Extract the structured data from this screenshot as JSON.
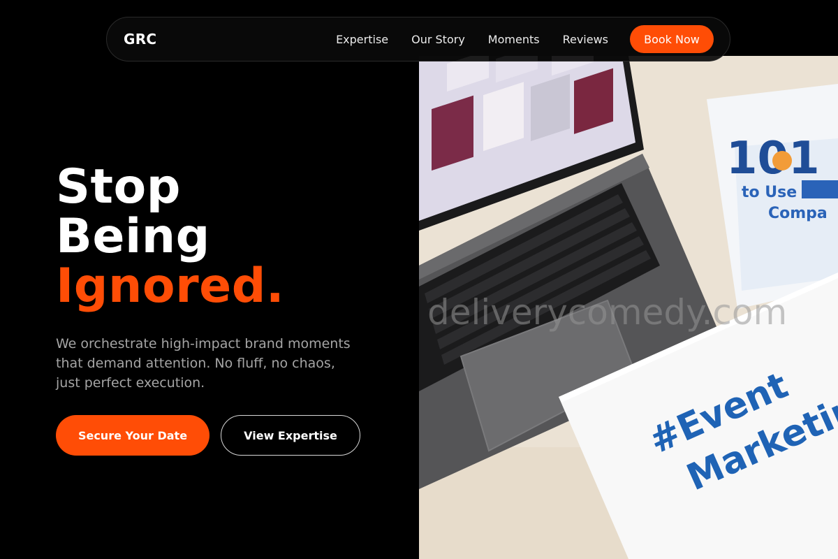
{
  "nav": {
    "brand": "GRC",
    "links": [
      "Expertise",
      "Our Story",
      "Moments",
      "Reviews"
    ],
    "cta": "Book Now"
  },
  "hero": {
    "headline_lines": [
      "Stop",
      "Being",
      "Ignored."
    ],
    "subheadline": "We orchestrate high-impact brand moments that demand attention. No fluff, no chaos, just perfect execution.",
    "primary_cta": "Secure Your Date",
    "secondary_cta": "View Expertise"
  },
  "photo": {
    "watermark": "deliverycomedy.com",
    "booklet_number": "101",
    "booklet_line1": "to Use Soc",
    "booklet_line2": "Compa",
    "card_line1": "#Event",
    "card_line2": "Marketing"
  },
  "colors": {
    "background": "#000000",
    "accent": "#ff4d06",
    "text_primary": "#ffffff",
    "text_muted": "#a5a5a5"
  }
}
